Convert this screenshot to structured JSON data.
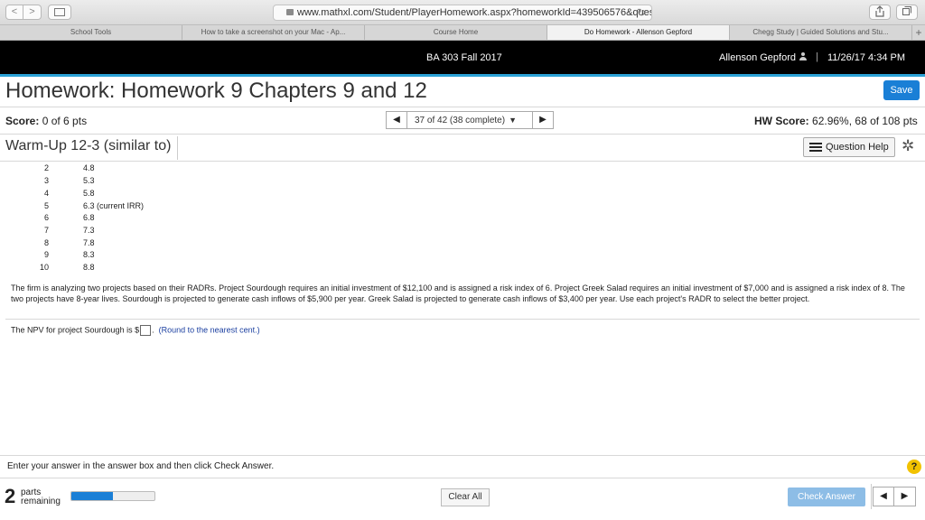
{
  "browser": {
    "url": "www.mathxl.com/Student/PlayerHomework.aspx?homeworkId=439506576&question",
    "back_glyph": "<",
    "forward_glyph": ">",
    "reload_glyph": "↻",
    "tabs": [
      {
        "label": "School Tools"
      },
      {
        "label": "How to take a screenshot on your Mac - Ap..."
      },
      {
        "label": "Course Home"
      },
      {
        "label": "Do Homework - Allenson Gepford"
      },
      {
        "label": "Chegg Study | Guided Solutions and Stu..."
      }
    ],
    "new_tab_glyph": "+"
  },
  "header": {
    "course": "BA 303 Fall 2017",
    "user": "Allenson Gepford",
    "separator": "|",
    "datetime": "11/26/17 4:34 PM"
  },
  "homework": {
    "title": "Homework: Homework 9 Chapters 9 and 12",
    "save_label": "Save",
    "score_label": "Score:",
    "score_value": "0 of 6 pts",
    "question_selector": "37 of 42 (38 complete)",
    "hw_score_label": "HW Score:",
    "hw_score_value": "62.96%, 68 of 108 pts"
  },
  "question": {
    "title": "Warm-Up 12-3 (similar to)",
    "help_label": "Question Help",
    "table": [
      {
        "year": "2",
        "value": "4.8"
      },
      {
        "year": "3",
        "value": "5.3"
      },
      {
        "year": "4",
        "value": "5.8"
      },
      {
        "year": "5",
        "value": "6.3 (current IRR)"
      },
      {
        "year": "6",
        "value": "6.8"
      },
      {
        "year": "7",
        "value": "7.3"
      },
      {
        "year": "8",
        "value": "7.8"
      },
      {
        "year": "9",
        "value": "8.3"
      },
      {
        "year": "10",
        "value": "8.8"
      }
    ],
    "problem_text": "The firm is analyzing two projects based on their RADRs. Project Sourdough requires an initial investment of $12,100 and is assigned a risk index of 6. Project Greek Salad requires an initial investment of $7,000 and is assigned a risk index of 8.  The two projects have 8-year lives. Sourdough is projected to generate cash inflows of $5,900 per year. Greek Salad is projected to generate cash inflows of $3,400 per year. Use each project's RADR to select the better project.",
    "npv_prefix": "The NPV for project Sourdough is $",
    "npv_value": "",
    "npv_suffix": ".",
    "npv_hint": "(Round to the nearest cent.)"
  },
  "footer": {
    "instruction": "Enter your answer in the answer box and then click Check Answer.",
    "help_glyph": "?",
    "parts_count": "2",
    "parts_line1": "parts",
    "parts_line2": "remaining",
    "progress_fraction": 0.5,
    "clear_label": "Clear All",
    "check_label": "Check Answer"
  },
  "colors": {
    "accent": "#1a7fd6",
    "header_bg": "#000000",
    "header_line": "#2aa1d6",
    "check_disabled": "#8dbde6",
    "hint_text": "#1b3fa0"
  }
}
